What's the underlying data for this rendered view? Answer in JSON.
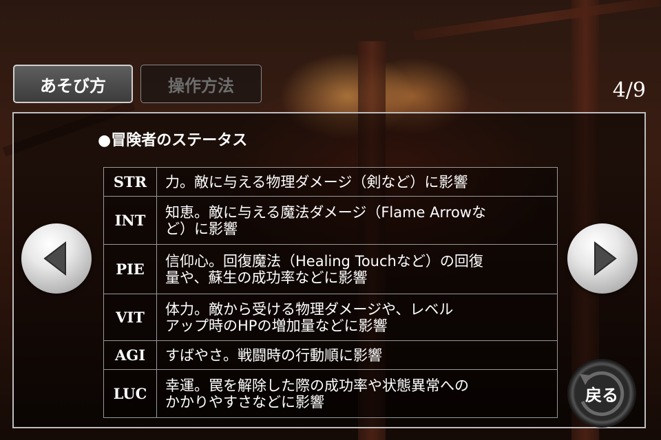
{
  "tabs": [
    {
      "label": "あそび方",
      "active": true
    },
    {
      "label": "操作方法",
      "active": false
    }
  ],
  "page_indicator": "4/9",
  "section": {
    "title": "●冒険者のステータス"
  },
  "stats": [
    {
      "key": "STR",
      "desc_lines": [
        "力。敵に与える物理ダメージ（剣など）に影響"
      ]
    },
    {
      "key": "INT",
      "desc_lines": [
        "知恵。敵に与える魔法ダメージ（Flame Arrowな",
        "ど）に影響"
      ]
    },
    {
      "key": "PIE",
      "desc_lines": [
        "信仰心。回復魔法（Healing Touchなど）の回復",
        "量や、蘇生の成功率などに影響"
      ]
    },
    {
      "key": "VIT",
      "desc_lines": [
        "体力。敵から受ける物理ダメージや、レベル",
        "アップ時のHPの増加量などに影響"
      ]
    },
    {
      "key": "AGI",
      "desc_lines": [
        "すばやさ。戦闘時の行動順に影響"
      ]
    },
    {
      "key": "LUC",
      "desc_lines": [
        "幸運。罠を解除した際の成功率や状態異常への",
        "かかりやすさなどに影響"
      ]
    }
  ],
  "nav": {
    "prev_icon": "left-triangle-icon",
    "next_icon": "right-triangle-icon",
    "back_label": "戻る",
    "back_icon": "return-arrow-icon"
  }
}
